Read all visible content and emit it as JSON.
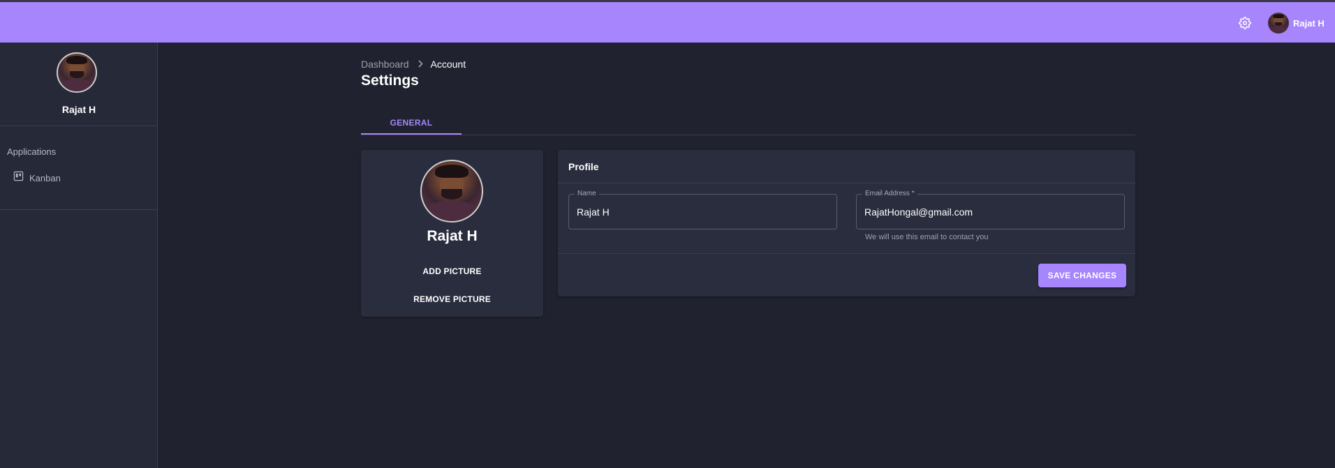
{
  "colors": {
    "accent": "#a685fd",
    "background": "#20222f",
    "sidebar": "#262938",
    "card": "#2a2d3e"
  },
  "topbar": {
    "settings_icon": "gear-icon",
    "user_name": "Rajat H"
  },
  "sidebar": {
    "user_name": "Rajat H",
    "section_title": "Applications",
    "items": [
      {
        "label": "Kanban",
        "icon": "kanban-board-icon"
      }
    ]
  },
  "breadcrumb": {
    "items": [
      "Dashboard",
      "Account"
    ],
    "separator_icon": "chevron-right-icon"
  },
  "page": {
    "title": "Settings"
  },
  "tabs": [
    {
      "label": "GENERAL",
      "active": true
    }
  ],
  "profile_card": {
    "name": "Rajat H",
    "add_picture_label": "ADD PICTURE",
    "remove_picture_label": "REMOVE PICTURE"
  },
  "profile_form": {
    "title": "Profile",
    "name_label": "Name",
    "name_value": "Rajat H",
    "email_label": "Email Address *",
    "email_value": "RajatHongal@gmail.com",
    "email_helper": "We will use this email to contact you",
    "save_label": "SAVE CHANGES"
  }
}
